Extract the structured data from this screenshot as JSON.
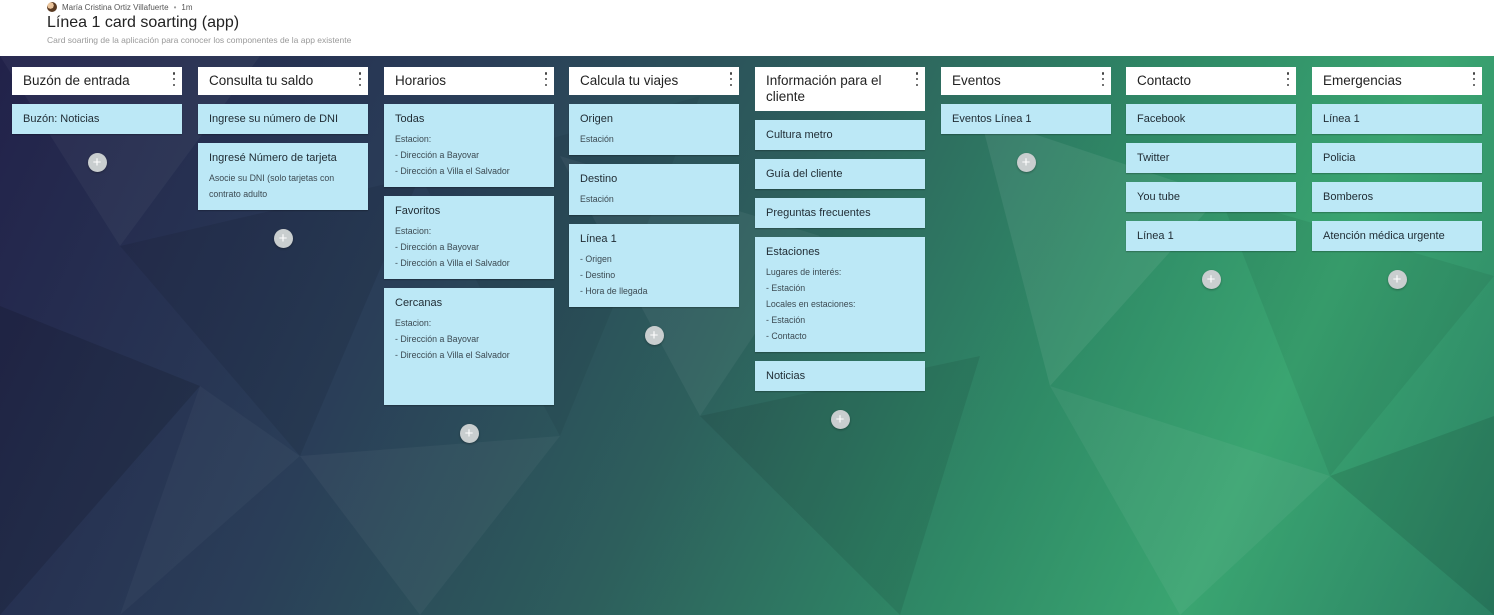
{
  "header": {
    "author": "María Cristina Ortiz Villafuerte",
    "separator": "•",
    "time": "1m",
    "title": "Línea 1 card soarting (app)",
    "subtitle": "Card soarting de la aplicación para conocer los componentes de la app existente"
  },
  "add_symbol": "+",
  "columns": [
    {
      "title": "Buzón de entrada",
      "cards": [
        {
          "title": "Buzón: Noticias",
          "lines": []
        }
      ]
    },
    {
      "title": "Consulta tu saldo",
      "cards": [
        {
          "title": "Ingrese su número de DNI",
          "lines": []
        },
        {
          "title": "Ingresé Número de tarjeta",
          "lines": [
            "Asocie su DNI (solo tarjetas con",
            "contrato adulto"
          ]
        }
      ]
    },
    {
      "title": "Horarios",
      "cards": [
        {
          "title": "Todas",
          "lines": [
            "Estacion:",
            "- Dirección a Bayovar",
            "- Dirección a Villa el Salvador"
          ]
        },
        {
          "title": "Favoritos",
          "lines": [
            "Estacion:",
            "- Dirección a Bayovar",
            "- Dirección a Villa el Salvador"
          ]
        },
        {
          "title": "Cercanas",
          "lines": [
            "Estacion:",
            "- Dirección a Bayovar",
            "- Dirección a Villa el Salvador"
          ]
        }
      ]
    },
    {
      "title": "Calcula tu viajes",
      "cards": [
        {
          "title": "Origen",
          "lines": [
            "Estación"
          ]
        },
        {
          "title": "Destino",
          "lines": [
            "Estación"
          ]
        },
        {
          "title": "Línea 1",
          "lines": [
            "- Origen",
            "- Destino",
            "- Hora de llegada"
          ]
        }
      ]
    },
    {
      "title": "Información para el cliente",
      "cards": [
        {
          "title": "Cultura metro",
          "lines": []
        },
        {
          "title": "Guía del cliente",
          "lines": []
        },
        {
          "title": "Preguntas frecuentes",
          "lines": []
        },
        {
          "title": "Estaciones",
          "lines": [
            "Lugares de interés:",
            "- Estación",
            "Locales en estaciones:",
            "- Estación",
            "- Contacto"
          ]
        },
        {
          "title": "Noticias",
          "lines": []
        }
      ]
    },
    {
      "title": "Eventos",
      "cards": [
        {
          "title": "Eventos Línea 1",
          "lines": []
        }
      ]
    },
    {
      "title": "Contacto",
      "cards": [
        {
          "title": "Facebook",
          "lines": []
        },
        {
          "title": "Twitter",
          "lines": []
        },
        {
          "title": "You tube",
          "lines": []
        },
        {
          "title": "Línea 1",
          "lines": []
        }
      ]
    },
    {
      "title": "Emergencias",
      "cards": [
        {
          "title": "Línea 1",
          "lines": []
        },
        {
          "title": "Policia",
          "lines": []
        },
        {
          "title": "Bomberos",
          "lines": []
        },
        {
          "title": "Atención médica urgente",
          "lines": []
        }
      ]
    }
  ]
}
